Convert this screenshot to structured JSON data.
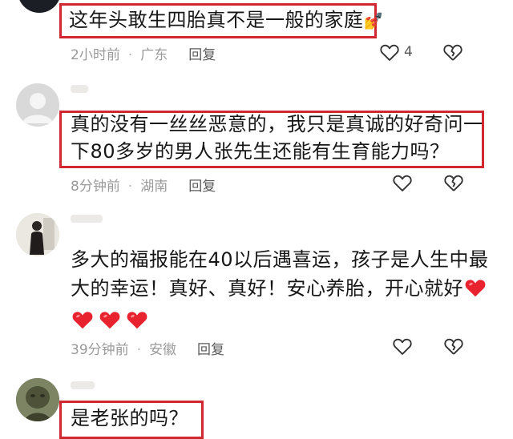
{
  "comments": [
    {
      "text": "这年头敢生四胎真不是一般的家庭",
      "emoji": "💅",
      "time": "2小时前",
      "location": "广东",
      "reply": "回复",
      "likes": "4"
    },
    {
      "line1": "真的没有一丝丝恶意的，我只是真诚的好奇问一",
      "line2": "下80多岁的男人张先生还能有生育能力吗？",
      "time": "8分钟前",
      "location": "湖南",
      "reply": "回复"
    },
    {
      "line1": "多大的福报能在40以后遇喜运，孩子是人生中最",
      "line2": "大的幸运！真好、真好！安心养胎，开心就好",
      "time": "39分钟前",
      "location": "安徽",
      "reply": "回复"
    },
    {
      "text": "是老张的吗？"
    }
  ],
  "icons": {
    "like": "heart-outline-icon",
    "dislike": "broken-heart-icon",
    "emoji_heart": "red-heart-icon"
  },
  "colors": {
    "highlight": "#d0282e",
    "heart": "#e8232f",
    "meta": "#9a9a9a"
  }
}
